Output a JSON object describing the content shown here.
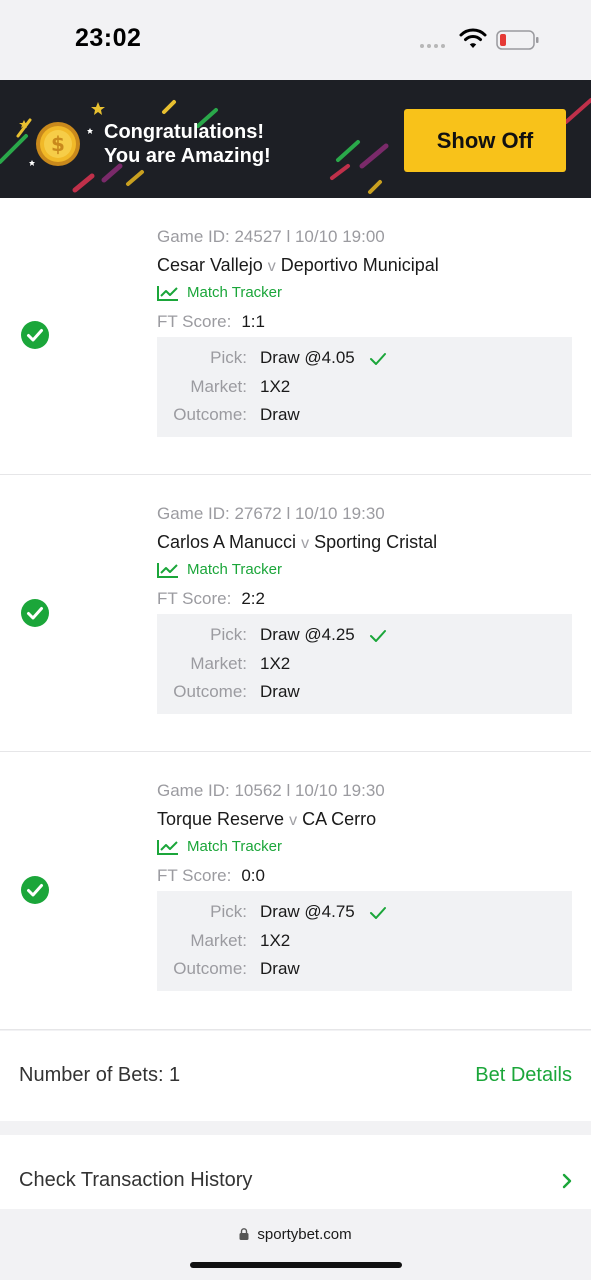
{
  "status_bar": {
    "time": "23:02"
  },
  "banner": {
    "line1": "Congratulations!",
    "line2": "You are Amazing!",
    "show_off_label": "Show Off"
  },
  "bets": [
    {
      "game_info": "Game ID: 24527 l 10/10 19:00",
      "home": "Cesar Vallejo",
      "vs": "v",
      "away": "Deportivo Municipal",
      "tracker_label": "Match Tracker",
      "ft_label": "FT Score:",
      "ft_score": "1:1",
      "pick_label": "Pick:",
      "pick_value": "Draw @4.05",
      "market_label": "Market:",
      "market_value": "1X2",
      "outcome_label": "Outcome:",
      "outcome_value": "Draw",
      "won": true
    },
    {
      "game_info": "Game ID: 27672 l 10/10 19:30",
      "home": "Carlos A Manucci",
      "vs": "v",
      "away": "Sporting Cristal",
      "tracker_label": "Match Tracker",
      "ft_label": "FT Score:",
      "ft_score": "2:2",
      "pick_label": "Pick:",
      "pick_value": "Draw @4.25",
      "market_label": "Market:",
      "market_value": "1X2",
      "outcome_label": "Outcome:",
      "outcome_value": "Draw",
      "won": true
    },
    {
      "game_info": "Game ID: 10562 l 10/10 19:30",
      "home": "Torque Reserve",
      "vs": "v",
      "away": "CA Cerro",
      "tracker_label": "Match Tracker",
      "ft_label": "FT Score:",
      "ft_score": "0:0",
      "pick_label": "Pick:",
      "pick_value": "Draw @4.75",
      "market_label": "Market:",
      "market_value": "1X2",
      "outcome_label": "Outcome:",
      "outcome_value": "Draw",
      "won": true
    }
  ],
  "summary": {
    "count_text": "Number of Bets: 1",
    "details_label": "Bet Details"
  },
  "transaction": {
    "label": "Check Transaction History"
  },
  "browser": {
    "url": "sportybet.com"
  },
  "colors": {
    "accent_green": "#1ba63a",
    "button_yellow": "#f8c21a",
    "banner_bg": "#1d1f25"
  }
}
